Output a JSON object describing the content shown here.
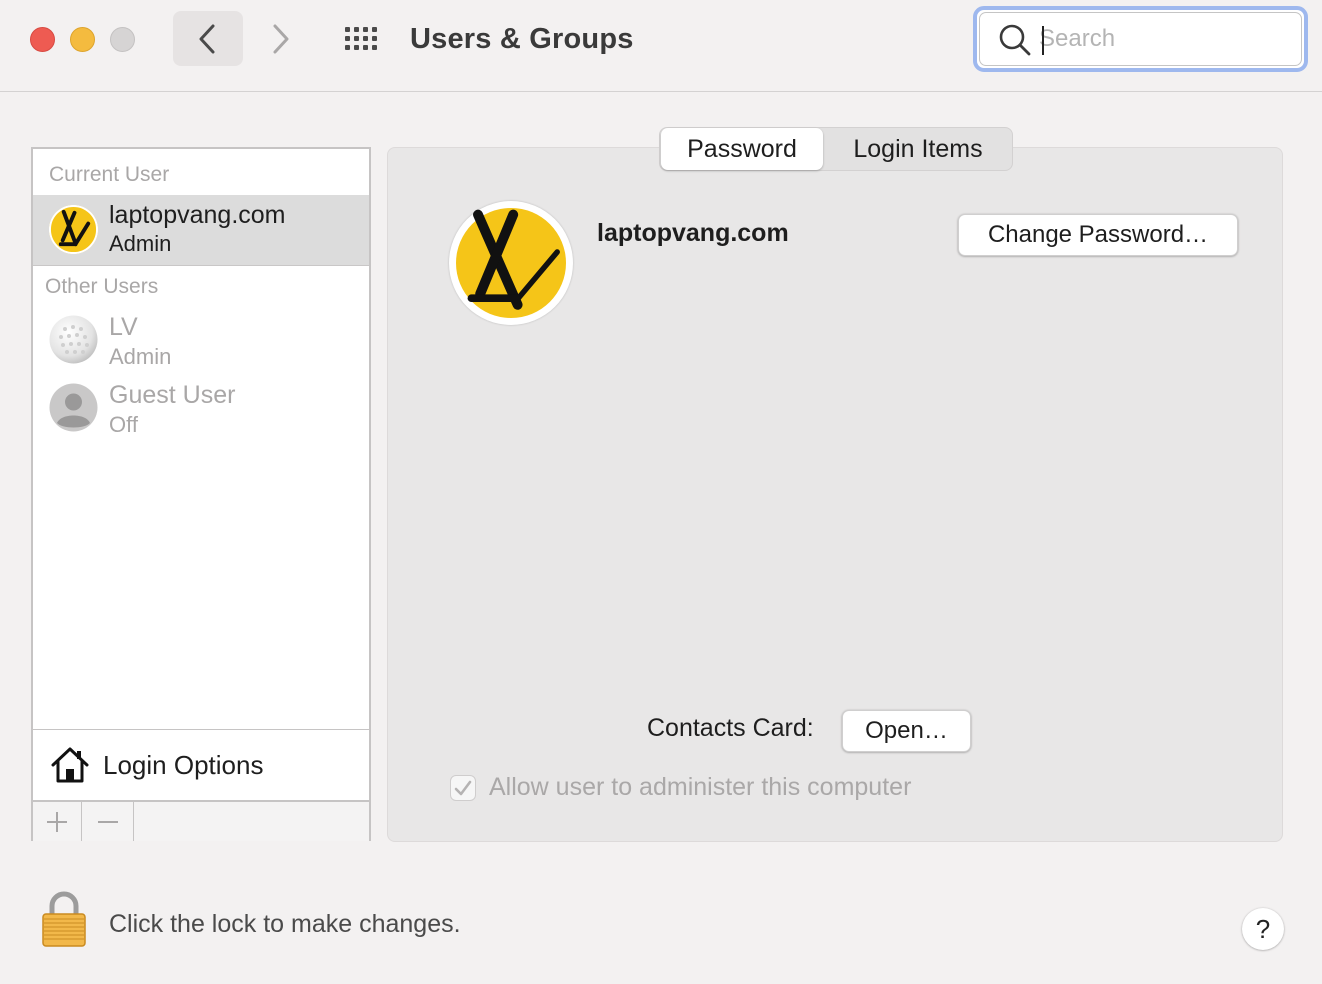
{
  "window": {
    "title": "Users & Groups",
    "search": {
      "placeholder": "Search",
      "value": ""
    }
  },
  "icons": {
    "close": "traffic-light-close",
    "minimize": "traffic-light-minimize",
    "zoom": "traffic-light-zoom",
    "back": "chevron-left-icon",
    "forward": "chevron-right-icon",
    "show_all": "grid-icon",
    "search": "magnifier-icon",
    "login_options": "house-icon",
    "lock": "lock-icon",
    "add": "plus-icon",
    "remove": "minus-icon"
  },
  "colors": {
    "close": "#ee5b52",
    "minimize": "#f4bb3f",
    "zoom": "#d6d4d4",
    "focus_ring": "#9eb8ee",
    "avatar_yellow": "#f5c518"
  },
  "sidebar": {
    "current_user_label": "Current User",
    "current_user": {
      "name": "laptopvang.com",
      "role": "Admin"
    },
    "other_users_label": "Other Users",
    "other_users": [
      {
        "name": "LV",
        "role": "Admin"
      },
      {
        "name": "Guest User",
        "role": "Off"
      }
    ],
    "login_options_label": "Login Options",
    "add_symbol": "+",
    "remove_symbol": "−"
  },
  "main": {
    "tabs": [
      {
        "label": "Password",
        "active": true
      },
      {
        "label": "Login Items",
        "active": false
      }
    ],
    "user_name": "laptopvang.com",
    "change_password_label": "Change Password…",
    "contacts_card_label": "Contacts Card:",
    "open_button_label": "Open…",
    "allow_admin": {
      "label": "Allow user to administer this computer",
      "checked": true,
      "enabled": false
    }
  },
  "footer": {
    "lock_message": "Click the lock to make changes.",
    "help_label": "?"
  }
}
